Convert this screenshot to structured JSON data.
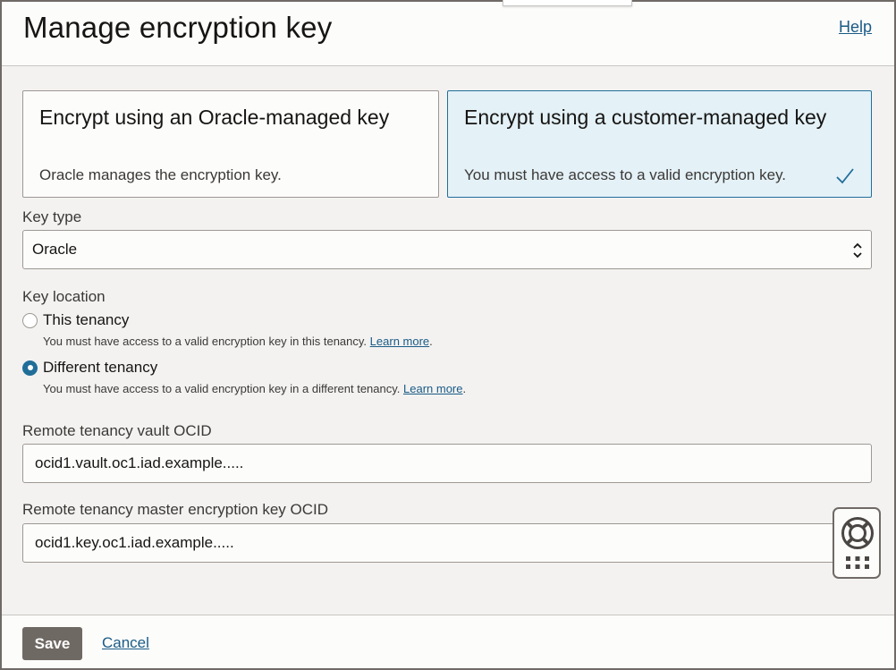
{
  "header": {
    "title": "Manage encryption key",
    "help_label": "Help"
  },
  "options": {
    "oracle": {
      "title": "Encrypt using an Oracle-managed key",
      "description": "Oracle manages the encryption key.",
      "selected": false
    },
    "customer": {
      "title": "Encrypt using a customer-managed key",
      "description": "You must have access to a valid encryption key.",
      "selected": true,
      "check_icon": "checkmark-icon"
    }
  },
  "key_type": {
    "label": "Key type",
    "value": "Oracle",
    "icon": "sort-arrows-icon"
  },
  "key_location": {
    "label": "Key location",
    "options": [
      {
        "label": "This tenancy",
        "hint": "You must have access to a valid encryption key in this tenancy.",
        "link": "Learn more",
        "checked": false
      },
      {
        "label": "Different tenancy",
        "hint": "You must have access to a valid encryption key in a different tenancy.",
        "link": "Learn more",
        "checked": true
      }
    ]
  },
  "vault_ocid": {
    "label": "Remote tenancy vault OCID",
    "value": "ocid1.vault.oc1.iad.example....."
  },
  "key_ocid": {
    "label": "Remote tenancy master encryption key OCID",
    "value": "ocid1.key.oc1.iad.example....."
  },
  "footer": {
    "save_label": "Save",
    "cancel_label": "Cancel"
  },
  "help_widget": {
    "icons": [
      "lifebuoy-icon",
      "grid-menu-icon"
    ]
  },
  "colors": {
    "accent": "#216e99",
    "link": "#1a5b86",
    "selected_card_bg": "#e4f1f7",
    "save_button": "#6f6964"
  }
}
